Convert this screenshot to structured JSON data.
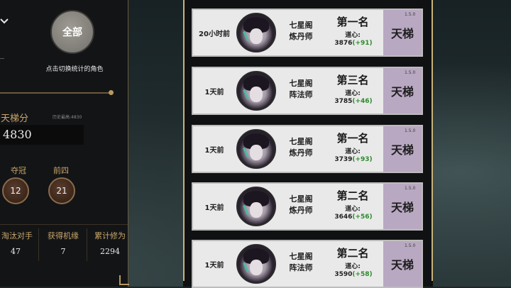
{
  "left_panel": {
    "chevron_icon": "chevron-down-icon",
    "all_button": "全部",
    "hint": "点击切换统计的角色",
    "ladder_title": "天梯分",
    "history_best": "历史最高:4830",
    "score": "4830",
    "circles": [
      {
        "label": "夺冠",
        "value": "12"
      },
      {
        "label": "前四",
        "value": "21"
      }
    ],
    "stats": [
      {
        "label": "淘汰对手",
        "value": "47"
      },
      {
        "label": "获得机缘",
        "value": "7"
      },
      {
        "label": "累计修为",
        "value": "2294"
      }
    ]
  },
  "matches": [
    {
      "time": "20小时前",
      "sect": "七星阁",
      "role": "炼丹师",
      "rank": "第一名",
      "dao_label": "道心:",
      "dao_value": "3876",
      "delta": "(+91)",
      "mode": "天梯",
      "version": "1.5.0"
    },
    {
      "time": "1天前",
      "sect": "七星阁",
      "role": "阵法师",
      "rank": "第三名",
      "dao_label": "道心:",
      "dao_value": "3785",
      "delta": "(+46)",
      "mode": "天梯",
      "version": "1.5.0"
    },
    {
      "time": "1天前",
      "sect": "七星阁",
      "role": "炼丹师",
      "rank": "第一名",
      "dao_label": "道心:",
      "dao_value": "3739",
      "delta": "(+93)",
      "mode": "天梯",
      "version": "1.5.0"
    },
    {
      "time": "1天前",
      "sect": "七星阁",
      "role": "炼丹师",
      "rank": "第二名",
      "dao_label": "道心:",
      "dao_value": "3646",
      "delta": "(+56)",
      "mode": "天梯",
      "version": "1.5.0"
    },
    {
      "time": "1天前",
      "sect": "七星阁",
      "role": "阵法师",
      "rank": "第二名",
      "dao_label": "道心:",
      "dao_value": "3590",
      "delta": "(+58)",
      "mode": "天梯",
      "version": "1.5.0"
    }
  ],
  "colors": {
    "gold": "#c9a76a",
    "delta_green": "#2e8a2e",
    "tag_purple": "#b9a8c2"
  }
}
